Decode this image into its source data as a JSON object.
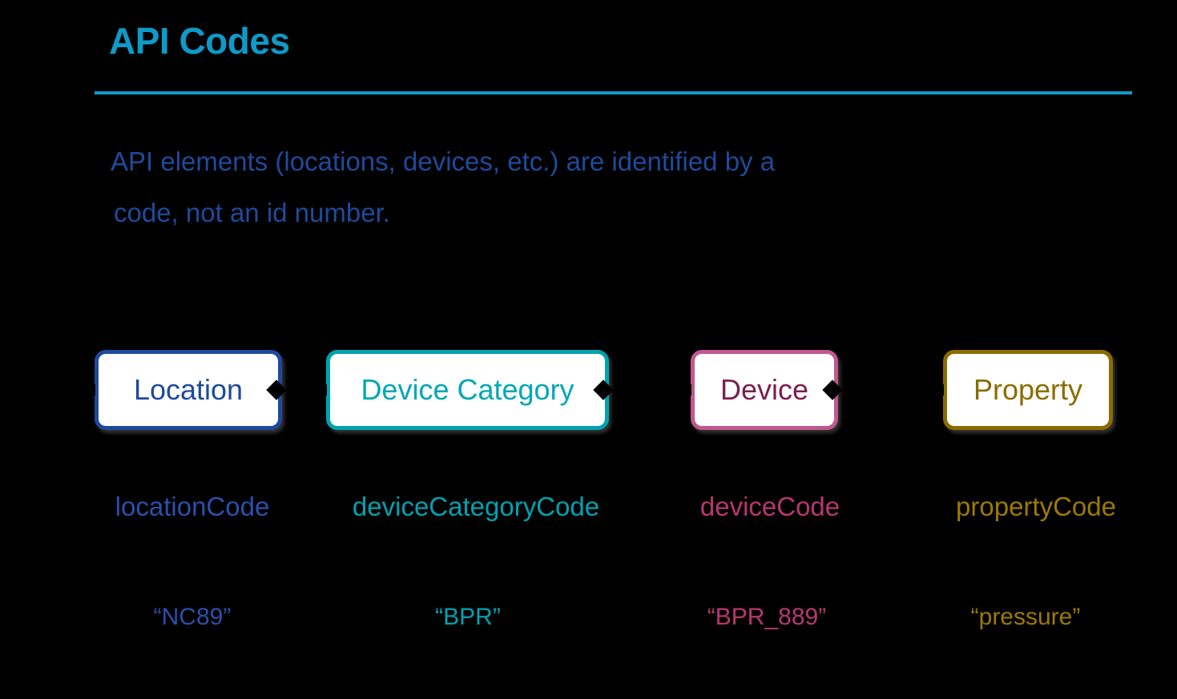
{
  "slide": {
    "title": "API Codes",
    "rule_color": "#0e9ac8",
    "title_color": "#0e9ac8",
    "background_color": "#000000"
  },
  "subtitle": {
    "line1": "API elements (locations, devices, etc.) are identified by a",
    "line2": "code, not an id number.",
    "color": "#1f4a9c"
  },
  "diagram": {
    "nodes": [
      {
        "label": "Location",
        "code": "locationCode",
        "example": "“NC89”",
        "border_color": "#1f4a9c",
        "label_color": "#1f4a9c",
        "code_color": "#2b50ab",
        "example_color": "#2b50ab",
        "fill_color": "#ffffff"
      },
      {
        "label": "Device Category",
        "code": "deviceCategoryCode",
        "example": "“BPR”",
        "border_color": "#00a2b0",
        "label_color": "#00a7b5",
        "code_color": "#00a2b0",
        "example_color": "#00a2b0",
        "fill_color": "#ffffff"
      },
      {
        "label": "Device",
        "code": "deviceCode",
        "example": "“BPR_889”",
        "border_color": "#c0588f",
        "label_color": "#7b2050",
        "code_color": "#b8376f",
        "example_color": "#b8376f",
        "fill_color": "#ffffff"
      },
      {
        "label": "Property",
        "code": "propertyCode",
        "example": "“pressure”",
        "border_color": "#8a6d00",
        "label_color": "#8a6d00",
        "code_color": "#9c7a00",
        "example_color": "#9c7a00",
        "fill_color": "#ffffff"
      }
    ],
    "connector_color": "#000000"
  }
}
